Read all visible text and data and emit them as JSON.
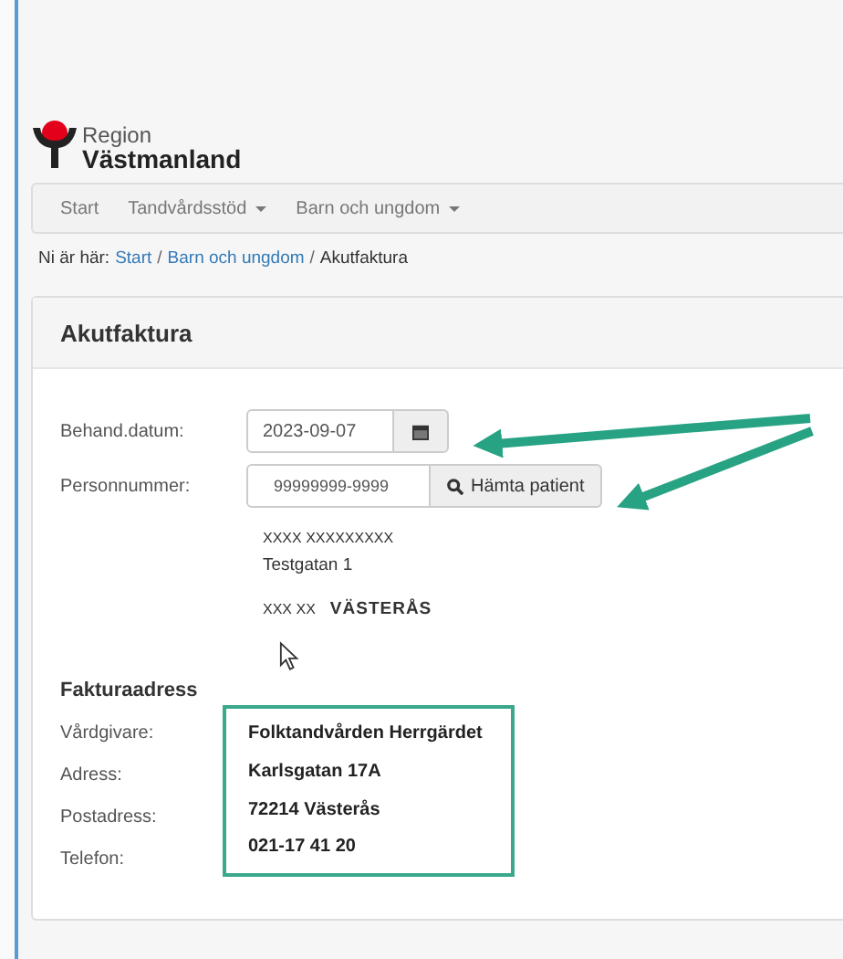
{
  "logo": {
    "line1": "Region",
    "line2": "Västmanland"
  },
  "nav": [
    {
      "label": "Start",
      "dropdown": false
    },
    {
      "label": "Tandvårdsstöd",
      "dropdown": true
    },
    {
      "label": "Barn och ungdom",
      "dropdown": true
    }
  ],
  "breadcrumb": {
    "label": "Ni är här:",
    "items": [
      {
        "text": "Start",
        "kind": "link"
      },
      {
        "text": "/",
        "kind": "separator"
      },
      {
        "text": "Barn och ungdom",
        "kind": "link"
      },
      {
        "text": "/",
        "kind": "separator"
      },
      {
        "text": "Akutfaktura",
        "kind": "current"
      }
    ]
  },
  "card": {
    "title": "Akutfaktura",
    "fields": [
      {
        "label": "Behand.datum:",
        "value": "2023-09-07",
        "kind": "date"
      },
      {
        "label": "Personnummer:",
        "value": "99999999-9999",
        "kind": "search",
        "button": "Hämta patient"
      }
    ],
    "patient": {
      "name": "XXXX XXXXXXXXX",
      "street": "Testgatan 1",
      "postcode": "XXX XX",
      "city": "VÄSTERÅS"
    },
    "invoice": {
      "heading": "Fakturaadress",
      "rows": [
        {
          "label": "Vårdgivare:",
          "value": "Folktandvården Herrgärdet"
        },
        {
          "label": "Adress:",
          "value": "Karlsgatan 17A"
        },
        {
          "label": "Postadress:",
          "value": "72214 Västerås"
        },
        {
          "label": "Telefon:",
          "value": "021-17 41 20"
        }
      ]
    }
  }
}
